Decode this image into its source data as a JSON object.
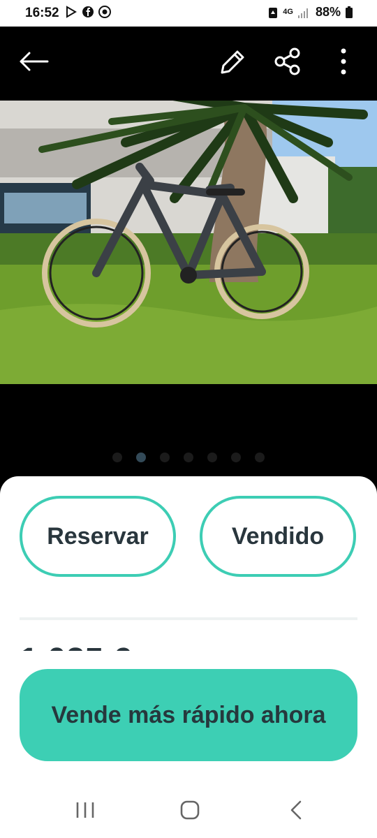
{
  "status_bar": {
    "time": "16:52",
    "network": "4G",
    "battery": "88%"
  },
  "topbar": {
    "icons": [
      "back-arrow-icon",
      "edit-pencil-icon",
      "share-icon",
      "more-vertical-icon"
    ]
  },
  "gallery": {
    "dot_count": 7,
    "active_index": 1
  },
  "actions": {
    "reserve_label": "Reservar",
    "sold_label": "Vendido"
  },
  "listing": {
    "price_partial": "1.025 €"
  },
  "cta": {
    "label": "Vende más rápido ahora"
  },
  "colors": {
    "accent": "#3DCDB4",
    "text_dark": "#29363D"
  }
}
